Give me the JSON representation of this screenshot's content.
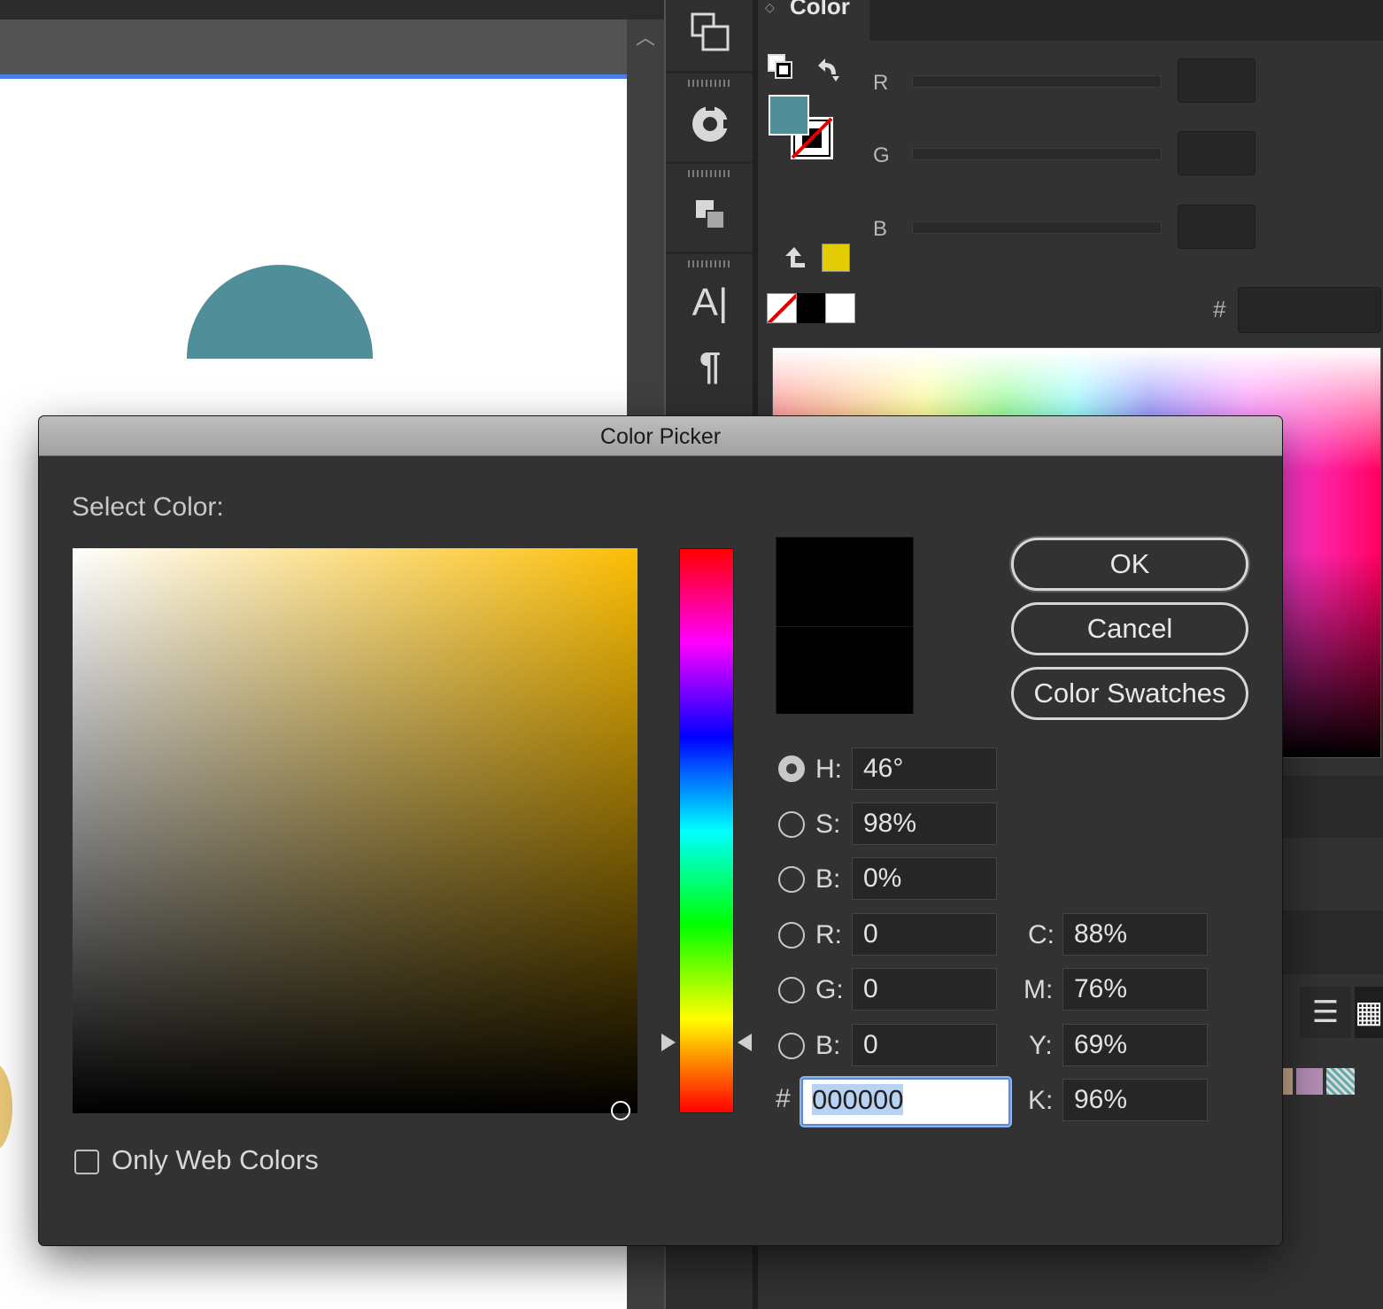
{
  "background_app": {
    "color_panel": {
      "title": "Color",
      "channels": [
        "R",
        "G",
        "B"
      ],
      "hex_symbol": "#",
      "fill_color": "#508f9a",
      "out_of_gamut_color": "#e1cc06"
    },
    "canvas": {
      "shape_color": "#508f9a"
    },
    "tools": [
      "artboards-icon",
      "gradient-icon",
      "pathfinder-icon",
      "character-icon",
      "paragraph-icon"
    ]
  },
  "dialog": {
    "title": "Color Picker",
    "select_label": "Select Color:",
    "buttons": {
      "ok": "OK",
      "cancel": "Cancel",
      "swatches": "Color Swatches"
    },
    "hsb": [
      {
        "label": "H:",
        "value": "46°",
        "selected": true
      },
      {
        "label": "S:",
        "value": "98%",
        "selected": false
      },
      {
        "label": "B:",
        "value": "0%",
        "selected": false
      }
    ],
    "rgb": [
      {
        "label": "R:",
        "value": "0"
      },
      {
        "label": "G:",
        "value": "0"
      },
      {
        "label": "B:",
        "value": "0"
      }
    ],
    "cmyk": [
      {
        "label": "C:",
        "value": "88%"
      },
      {
        "label": "M:",
        "value": "76%"
      },
      {
        "label": "Y:",
        "value": "69%"
      },
      {
        "label": "K:",
        "value": "96%"
      }
    ],
    "hex": {
      "label": "#",
      "value": "000000"
    },
    "web_only": {
      "label": "Only Web Colors",
      "checked": false
    },
    "preview": {
      "new_color": "#000000",
      "current_color": "#000000"
    },
    "hue_color": "#fcbe04"
  }
}
